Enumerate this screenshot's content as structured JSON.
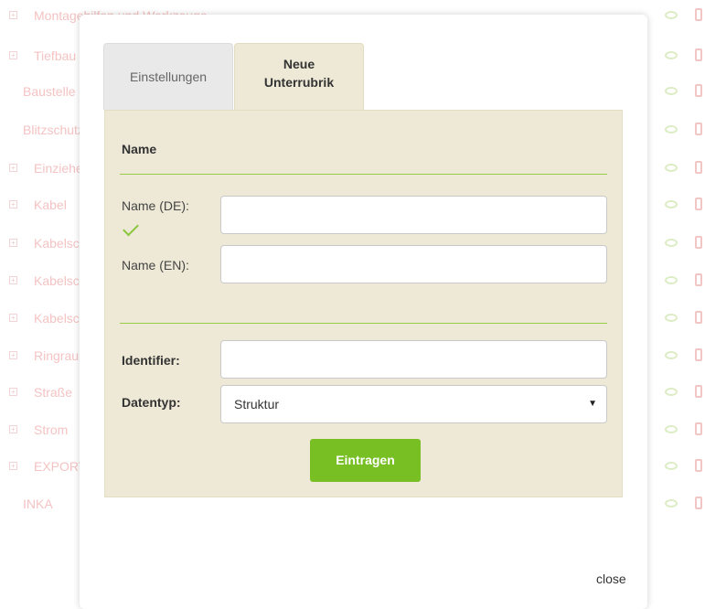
{
  "background": {
    "rows": [
      {
        "label": "Montagehilfen und Werkzeuge",
        "expander": true
      },
      {
        "label": "Tiefbau",
        "expander": true
      },
      {
        "label": "Baustelle",
        "expander": false
      },
      {
        "label": "Blitzschutz",
        "expander": false
      },
      {
        "label": "Einziehen",
        "expander": true
      },
      {
        "label": "Kabel",
        "expander": true
      },
      {
        "label": "Kabelschutz",
        "expander": true
      },
      {
        "label": "Kabelschellen",
        "expander": true
      },
      {
        "label": "Kabelschuhe",
        "expander": true
      },
      {
        "label": "Ringraum",
        "expander": true
      },
      {
        "label": "Straße",
        "expander": true
      },
      {
        "label": "Strom",
        "expander": true
      },
      {
        "label": "EXPORT",
        "expander": true
      },
      {
        "label": "INKA",
        "expander": false
      }
    ]
  },
  "modal": {
    "tabs": [
      {
        "label": "Einstellungen"
      },
      {
        "label": "Neue\nUnterrubrik"
      }
    ],
    "section_title": "Name",
    "name_de_label": "Name (DE):",
    "name_de_value": "",
    "name_en_label": "Name (EN):",
    "name_en_value": "",
    "identifier_label": "Identifier:",
    "identifier_value": "",
    "datatype_label": "Datentyp:",
    "datatype_value": "Struktur",
    "submit_label": "Eintragen",
    "close_label": "close"
  },
  "colors": {
    "accent_green": "#77bf22",
    "panel_bg": "#ede9d6",
    "faded_red_text": "#f4c3c3"
  }
}
